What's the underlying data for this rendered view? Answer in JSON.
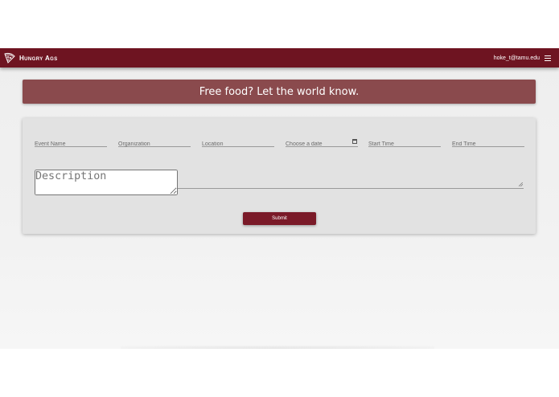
{
  "navbar": {
    "brand_name": "Hungry Ags",
    "user_email": "hoke_t@tamu.edu",
    "logo_icon": "pizza-slice-icon",
    "menu_icon": "hamburger-menu-icon",
    "bg_color": "#6e1421"
  },
  "banner": {
    "title": "Free food? Let the world know.",
    "bg_color": "#8a4a4d"
  },
  "form": {
    "event_name_placeholder": "Event Name",
    "organization_placeholder": "Organization",
    "location_placeholder": "Location",
    "date_placeholder": "Choose a date",
    "date_icon": "calendar-icon",
    "start_time_placeholder": "Start Time",
    "end_time_placeholder": "End Time",
    "description_placeholder": "Description",
    "submit_label": "Submit",
    "submit_color": "#7a1a28"
  }
}
